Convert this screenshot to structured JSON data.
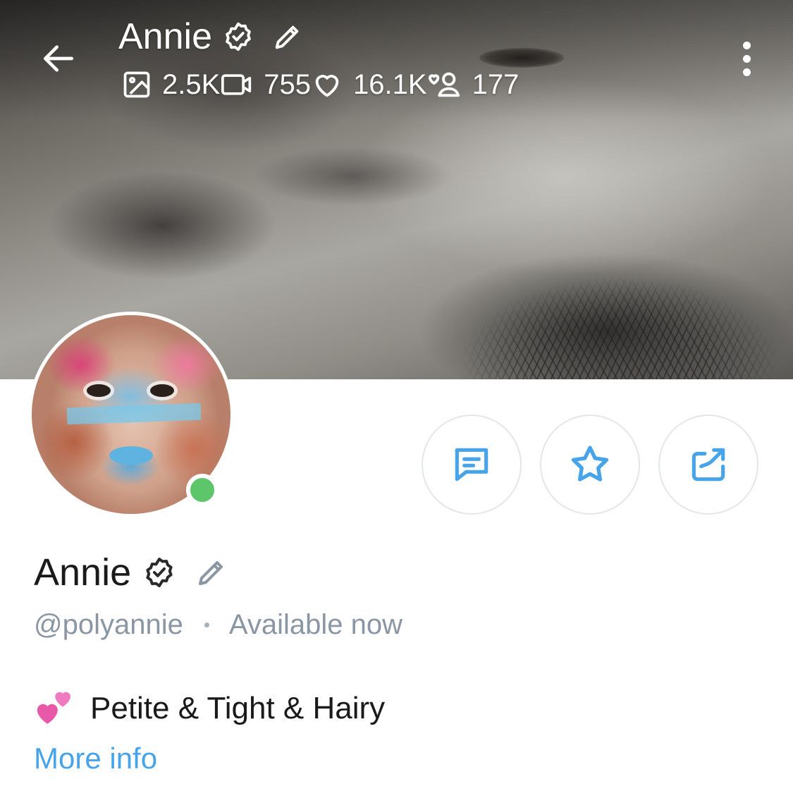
{
  "header": {
    "name": "Annie",
    "stats": {
      "photos": "2.5K",
      "videos": "755",
      "likes": "16.1K",
      "fans": "177"
    }
  },
  "profile": {
    "name": "Annie",
    "handle": "@polyannie",
    "status": "Available now",
    "bio": "Petite & Tight & Hairy",
    "bio_emoji": "two-hearts",
    "more_info_label": "More info",
    "online": true
  },
  "colors": {
    "accent": "#47a4e8",
    "online": "#5ec66a",
    "muted": "#8a96a3",
    "button_border": "#e3e6ea"
  },
  "icons": {
    "back": "arrow-left-icon",
    "verified": "verified-badge-icon",
    "edit": "pencil-icon",
    "photos": "image-icon",
    "videos": "video-icon",
    "likes": "heart-icon",
    "fans": "fans-icon",
    "menu": "more-vertical-icon",
    "message": "message-icon",
    "favorite": "star-icon",
    "share": "share-icon"
  }
}
